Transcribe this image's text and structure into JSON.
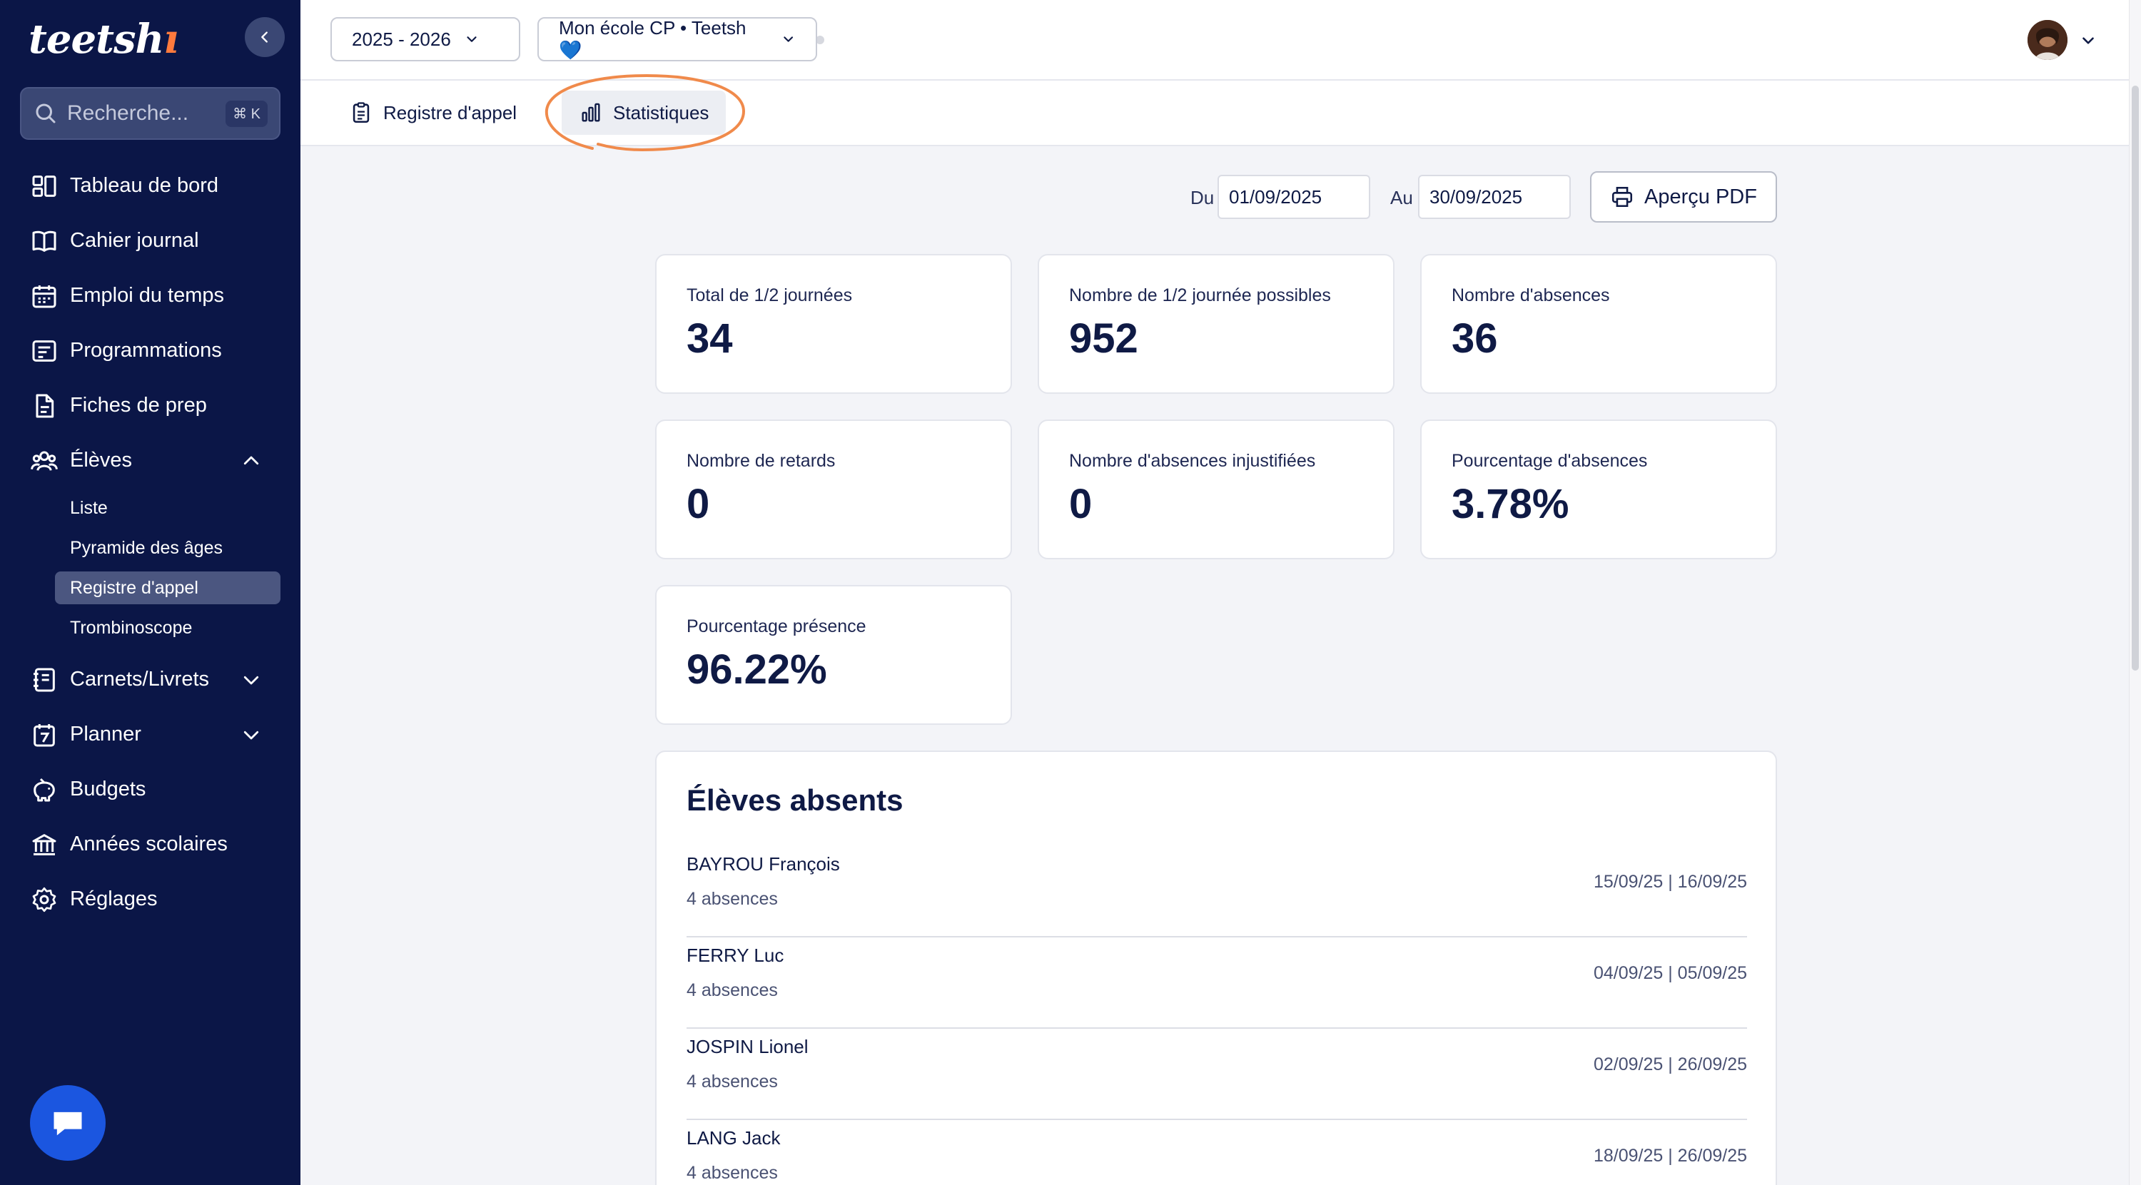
{
  "sidebar": {
    "logo": "teetsh",
    "search": {
      "placeholder": "Recherche...",
      "shortcut": "⌘ K"
    },
    "items": [
      {
        "label": "Tableau de bord",
        "icon": "dashboard-icon"
      },
      {
        "label": "Cahier journal",
        "icon": "book-icon"
      },
      {
        "label": "Emploi du temps",
        "icon": "calendar-icon"
      },
      {
        "label": "Programmations",
        "icon": "list-icon"
      },
      {
        "label": "Fiches de prep",
        "icon": "document-icon"
      },
      {
        "label": "Élèves",
        "icon": "users-icon",
        "expanded": true
      }
    ],
    "sub_items": [
      {
        "label": "Liste"
      },
      {
        "label": "Pyramide des âges"
      },
      {
        "label": "Registre d'appel",
        "active": true
      },
      {
        "label": "Trombinoscope"
      }
    ],
    "items_after": [
      {
        "label": "Carnets/Livrets",
        "icon": "notebook-icon"
      },
      {
        "label": "Planner",
        "icon": "planner-icon"
      },
      {
        "label": "Budgets",
        "icon": "piggy-bank-icon"
      },
      {
        "label": "Années scolaires",
        "icon": "bank-icon"
      },
      {
        "label": "Réglages",
        "icon": "gear-icon"
      }
    ]
  },
  "topbar": {
    "year_select": "2025 - 2026",
    "class_select": "Mon école CP • Teetsh 💙"
  },
  "tabs": [
    {
      "label": "Registre d'appel",
      "active": false
    },
    {
      "label": "Statistiques",
      "active": true
    }
  ],
  "filters": {
    "from_label": "Du",
    "from_value": "01/09/2025",
    "to_label": "Au",
    "to_value": "30/09/2025",
    "pdf_button": "Aperçu PDF"
  },
  "stats": [
    {
      "label": "Total de 1/2 journées",
      "value": "34"
    },
    {
      "label": "Nombre de 1/2 journée possibles",
      "value": "952"
    },
    {
      "label": "Nombre d'absences",
      "value": "36"
    },
    {
      "label": "Nombre de retards",
      "value": "0"
    },
    {
      "label": "Nombre d'absences injustifiées",
      "value": "0"
    },
    {
      "label": "Pourcentage d'absences",
      "value": "3.78%"
    },
    {
      "label": "Pourcentage présence",
      "value": "96.22%"
    }
  ],
  "absent_students": {
    "title": "Élèves absents",
    "rows": [
      {
        "name": "BAYROU François",
        "count": "4 absences",
        "dates": "15/09/25 | 16/09/25"
      },
      {
        "name": "FERRY Luc",
        "count": "4 absences",
        "dates": "04/09/25 | 05/09/25"
      },
      {
        "name": "JOSPIN Lionel",
        "count": "4 absences",
        "dates": "02/09/25 | 26/09/25"
      },
      {
        "name": "LANG Jack",
        "count": "4 absences",
        "dates": "18/09/25 | 26/09/25"
      }
    ]
  },
  "colors": {
    "sidebar_bg": "#0b1647",
    "accent_orange": "#f08a4b",
    "chat_blue": "#1b56e0",
    "text_primary": "#0f1a45"
  }
}
